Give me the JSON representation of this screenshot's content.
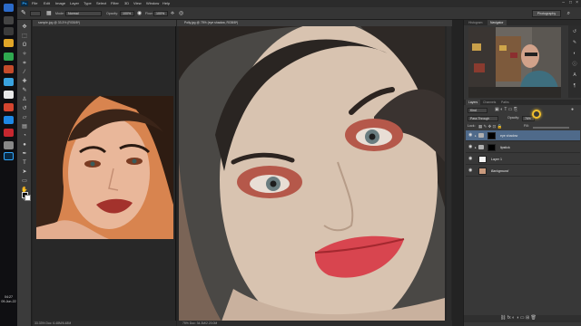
{
  "taskbar": {
    "time": "04:27",
    "date": "09-Jun-22"
  },
  "menubar": {
    "app_logo": "Ps",
    "items": [
      "File",
      "Edit",
      "Image",
      "Layer",
      "Type",
      "Select",
      "Filter",
      "3D",
      "View",
      "Window",
      "Help"
    ]
  },
  "options_bar": {
    "mode_label": "Mode:",
    "mode_value": "Normal",
    "opacity_label": "Opacity:",
    "opacity_value": "100%",
    "flow_label": "Flow:",
    "flow_value": "100%",
    "workspace": "Photography"
  },
  "left_document": {
    "tab_title": "sample.jpg @ 33.3% (RGB/8*)",
    "status": "33.33%  Doc: 6.48M/6.48M"
  },
  "main_document": {
    "tab_title": "Polly.jpg @ 75% (eye shadow, RGB/8*)",
    "status": "75%  Doc: 34.3M/2.20.0M"
  },
  "navigator_panel": {
    "tabs": [
      "Histogram",
      "Navigator"
    ],
    "active_tab": "Navigator"
  },
  "layers_panel": {
    "tabs": [
      "Layers",
      "Channels",
      "Paths"
    ],
    "active_tab": "Layers",
    "kind_filter": "Kind",
    "blend_mode": "Pass Through",
    "opacity_label": "Opacity:",
    "opacity_value": "76%",
    "lock_label": "Lock:",
    "fill_label": "Fill:",
    "layers": [
      {
        "name": "eye shadow",
        "type": "group",
        "selected": true
      },
      {
        "name": "lipstick",
        "type": "group",
        "selected": false
      },
      {
        "name": "Layer 1",
        "type": "pixel",
        "selected": false
      },
      {
        "name": "Background",
        "type": "background",
        "selected": false
      }
    ]
  },
  "colors": {
    "accent_selected_layer": "#4f6a8a",
    "cursor_highlight": "#f2c12e",
    "photo_backdrop_orange": "#d8844f"
  }
}
